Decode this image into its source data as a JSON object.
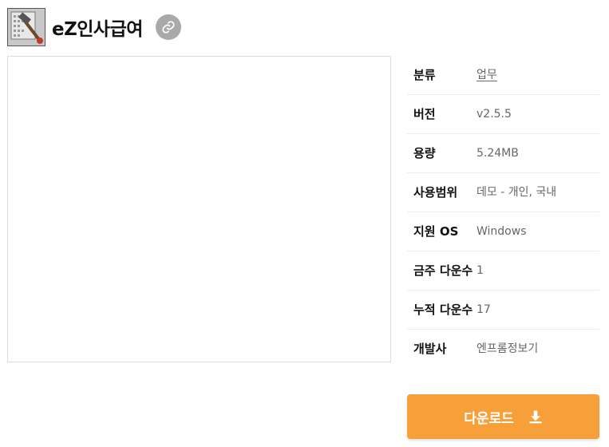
{
  "header": {
    "title": "eZ인사급여",
    "app_icon": "hammer-document-icon",
    "link_icon": "link-icon"
  },
  "info": {
    "rows": [
      {
        "label": "분류",
        "value": "업무"
      },
      {
        "label": "버전",
        "value": "v2.5.5"
      },
      {
        "label": "용량",
        "value": "5.24MB"
      },
      {
        "label": "사용범위",
        "value": "데모 - 개인, 국내"
      },
      {
        "label": "지원 OS",
        "value": "Windows"
      },
      {
        "label": "금주 다운수",
        "value": "1"
      },
      {
        "label": "누적 다운수",
        "value": "17"
      },
      {
        "label": "개발사",
        "value": "엔프롬정보기"
      }
    ]
  },
  "download": {
    "label": "다운로드",
    "icon": "download-icon",
    "color": "#f7a03a"
  }
}
